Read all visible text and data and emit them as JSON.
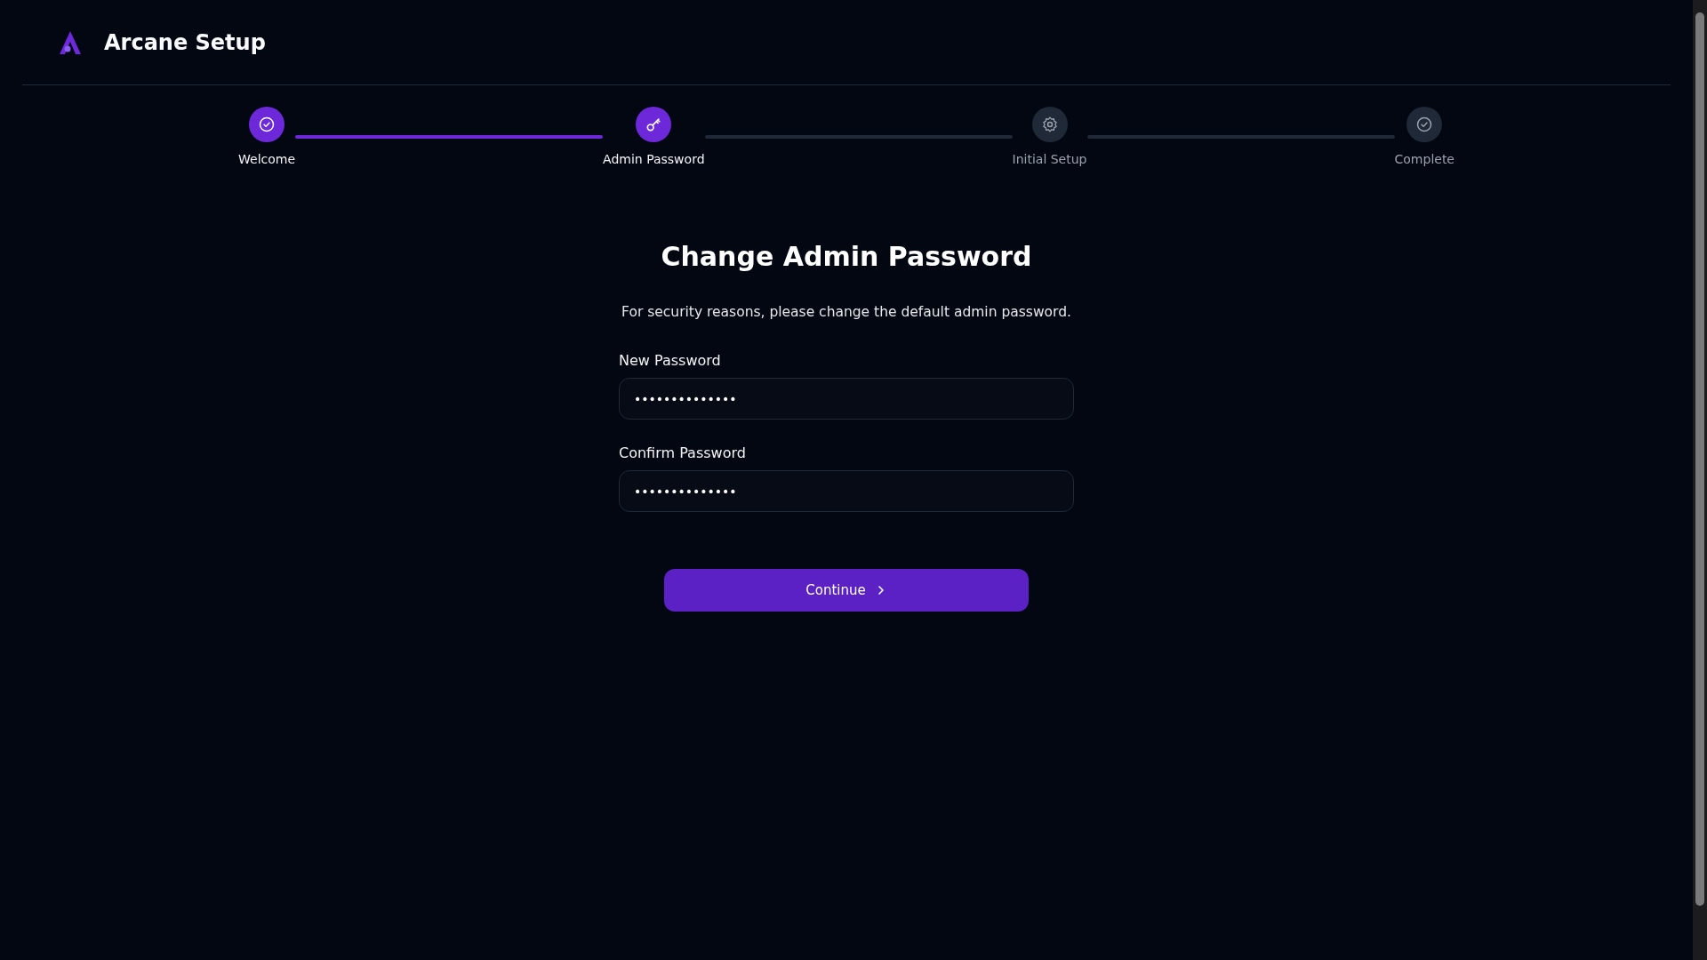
{
  "header": {
    "title": "Arcane Setup"
  },
  "steps": [
    {
      "label": "Welcome",
      "completed": true,
      "active": false,
      "kind": "check"
    },
    {
      "label": "Admin Password",
      "completed": false,
      "active": true,
      "kind": "key"
    },
    {
      "label": "Initial Setup",
      "completed": false,
      "active": false,
      "kind": "gear"
    },
    {
      "label": "Complete",
      "completed": false,
      "active": false,
      "kind": "check"
    }
  ],
  "form": {
    "heading": "Change Admin Password",
    "description": "For security reasons, please change the default admin password.",
    "fields": [
      {
        "label": "New Password",
        "value": "••••••••••••••"
      },
      {
        "label": "Confirm Password",
        "value": "••••••••••••••"
      }
    ],
    "button": {
      "label": "Continue"
    }
  }
}
